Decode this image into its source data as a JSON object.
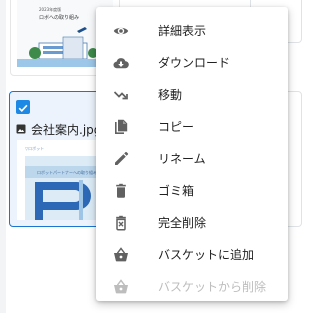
{
  "file_card": {
    "name": "会社案内.jpg",
    "checked": true
  },
  "top_thumbnail": {
    "caption_line1": "2023年度版",
    "caption_line2": "ロボへの取り組み"
  },
  "doc_thumbnail": {
    "header_text": "▽ロボット",
    "banner_text": "ロボットパートナーへの取り組み"
  },
  "colors": {
    "accent": "#1976d2",
    "checkbox": "#1e88e5",
    "icon": "#616161",
    "icon_disabled": "#bdbdbd",
    "text": "#212121",
    "text_disabled": "#bdbdbd"
  },
  "context_menu": {
    "items": [
      {
        "label": "詳細表示",
        "icon": "eye-icon",
        "enabled": true
      },
      {
        "label": "ダウンロード",
        "icon": "cloud-download-icon",
        "enabled": true
      },
      {
        "label": "移動",
        "icon": "move-arrow-icon",
        "enabled": true
      },
      {
        "label": "コピー",
        "icon": "copy-icon",
        "enabled": true
      },
      {
        "label": "リネーム",
        "icon": "pencil-icon",
        "enabled": true
      },
      {
        "label": "ゴミ箱",
        "icon": "trash-icon",
        "enabled": true
      },
      {
        "label": "完全削除",
        "icon": "delete-forever-icon",
        "enabled": true
      },
      {
        "label": "バスケットに追加",
        "icon": "basket-icon",
        "enabled": true
      },
      {
        "label": "バスケットから削除",
        "icon": "basket-icon",
        "enabled": false
      }
    ]
  }
}
